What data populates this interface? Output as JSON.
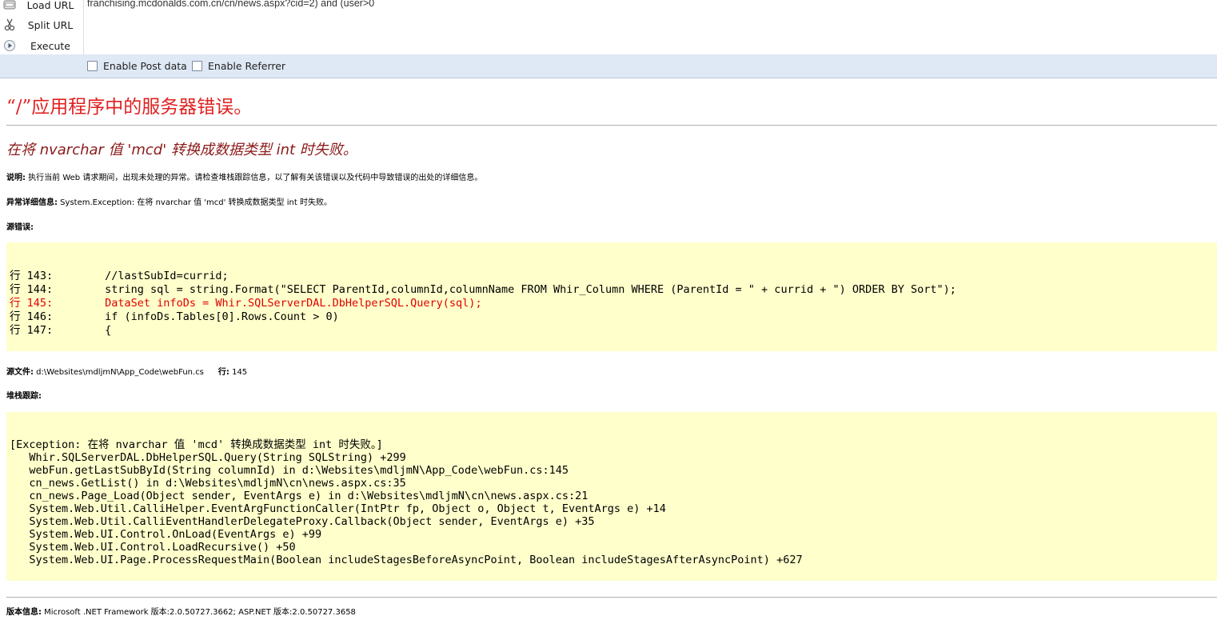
{
  "toolbar": {
    "load_url": "Load URL",
    "split_url": "Split URL",
    "execute": "Execute",
    "url_value": "franchising.mcdonalds.com.cn/cn/news.aspx?cid=2) and (user>0",
    "enable_post": "Enable Post data",
    "enable_referrer": "Enable Referrer"
  },
  "error": {
    "title": "“/”应用程序中的服务器错误。",
    "subtitle": "在将 nvarchar 值 'mcd' 转换成数据类型 int 时失败。",
    "description_label": "说明:",
    "description_text": " 执行当前 Web 请求期间，出现未处理的异常。请检查堆栈跟踪信息，以了解有关该错误以及代码中导致错误的出处的详细信息。",
    "exception_label": "异常详细信息:",
    "exception_text": " System.Exception: 在将 nvarchar 值 'mcd' 转换成数据类型 int 时失败。",
    "source_error_label": "源错误:",
    "source_lines": [
      "行 143:        //lastSubId=currid;",
      "行 144:        string sql = string.Format(\"SELECT ParentId,columnId,columnName FROM Whir_Column WHERE (ParentId = \" + currid + \") ORDER BY Sort\");",
      "行 145:        DataSet infoDs = Whir.SQLServerDAL.DbHelperSQL.Query(sql);",
      "行 146:        if (infoDs.Tables[0].Rows.Count > 0)",
      "行 147:        {"
    ],
    "source_file_label": "源文件:",
    "source_file_value": " d:\\Websites\\mdljmN\\App_Code\\webFun.cs",
    "line_label": "行:",
    "line_value": " 145",
    "stack_label": "堆栈跟踪:",
    "stack_lines": [
      "[Exception: 在将 nvarchar 值 'mcd' 转换成数据类型 int 时失败。]",
      "   Whir.SQLServerDAL.DbHelperSQL.Query(String SQLString) +299",
      "   webFun.getLastSubById(String columnId) in d:\\Websites\\mdljmN\\App_Code\\webFun.cs:145",
      "   cn_news.GetList() in d:\\Websites\\mdljmN\\cn\\news.aspx.cs:35",
      "   cn_news.Page_Load(Object sender, EventArgs e) in d:\\Websites\\mdljmN\\cn\\news.aspx.cs:21",
      "   System.Web.Util.CalliHelper.EventArgFunctionCaller(IntPtr fp, Object o, Object t, EventArgs e) +14",
      "   System.Web.Util.CalliEventHandlerDelegateProxy.Callback(Object sender, EventArgs e) +35",
      "   System.Web.UI.Control.OnLoad(EventArgs e) +99",
      "   System.Web.UI.Control.LoadRecursive() +50",
      "   System.Web.UI.Page.ProcessRequestMain(Boolean includeStagesBeforeAsyncPoint, Boolean includeStagesAfterAsyncPoint) +627"
    ],
    "version_label": "版本信息:",
    "version_text": " Microsoft .NET Framework 版本:2.0.50727.3662; ASP.NET 版本:2.0.50727.3658"
  },
  "colors": {
    "title_red": "#e02020",
    "subtitle_maroon": "#8b1a1a",
    "code_bg": "#ffffcc",
    "highlight_line": "#e00000",
    "toolbar_bar": "#dfe9f5"
  }
}
